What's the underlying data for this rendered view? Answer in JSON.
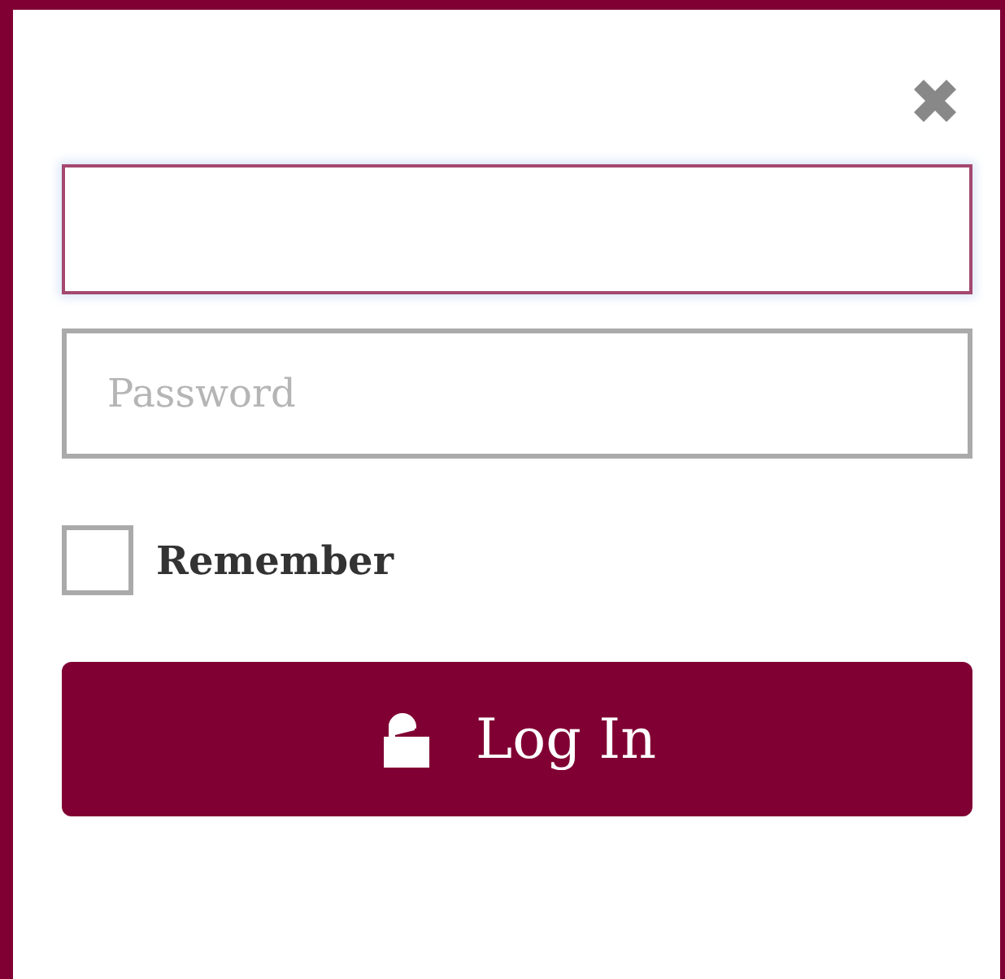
{
  "username": {
    "focused": true
  },
  "password": {
    "placeholder": "Password"
  },
  "remember": {
    "label": "Remember",
    "checked": false
  },
  "login_button": {
    "label": "Log In"
  }
}
